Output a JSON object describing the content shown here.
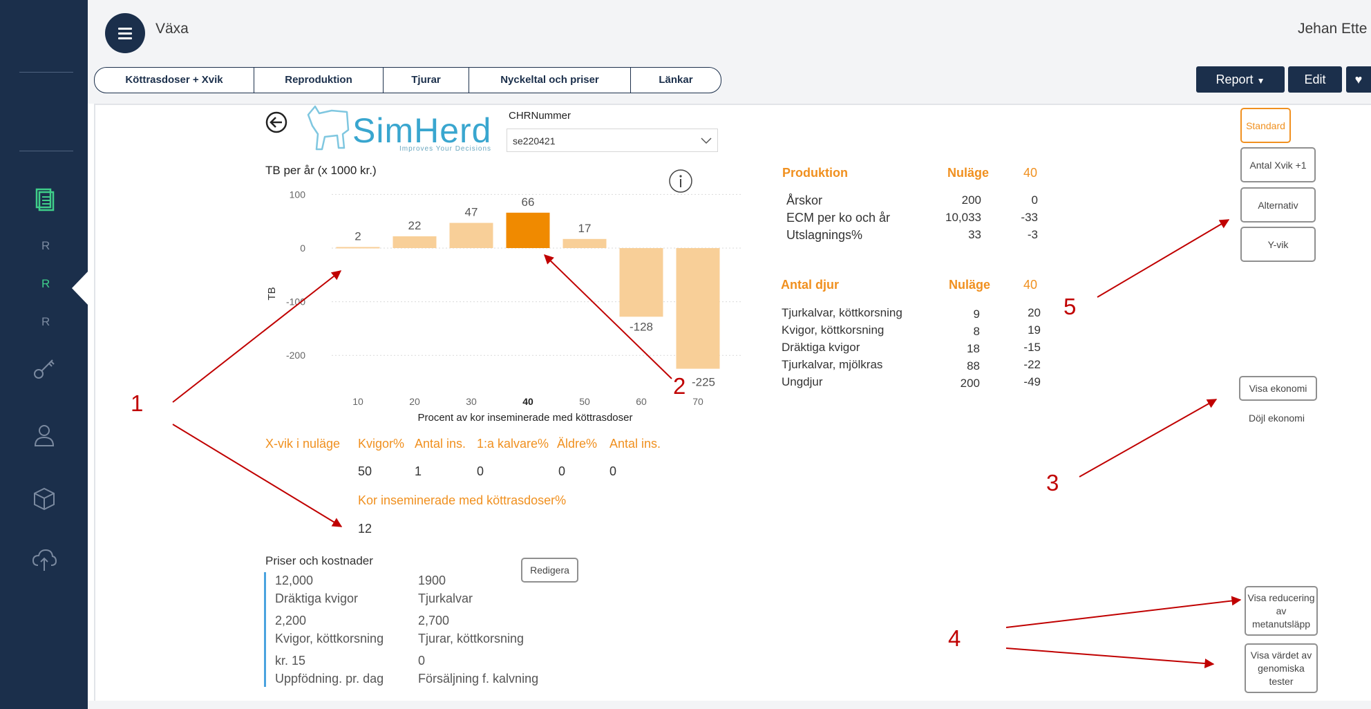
{
  "app": {
    "title": "Växa",
    "user": "Jehan Ette"
  },
  "sidebar": {
    "items": [
      {
        "label": "R",
        "active": false
      },
      {
        "label": "R",
        "active": true
      },
      {
        "label": "R",
        "active": false
      }
    ],
    "icons": [
      "report-icon",
      "key-icon",
      "user-icon",
      "cube-icon",
      "cloud-upload-icon"
    ]
  },
  "tabs": [
    "Köttrasdoser + Xvik",
    "Reproduktion",
    "Tjurar",
    "Nyckeltal och priser",
    "Länkar"
  ],
  "toolbar": {
    "report_label": "Report",
    "edit_label": "Edit",
    "favorite_icon": "heart-icon"
  },
  "header": {
    "logo_text": "SimHerd",
    "logo_tagline": "Improves Your Decisions",
    "chr_label": "CHRNummer",
    "chr_value": "se220421"
  },
  "chart_data": {
    "type": "bar",
    "title": "TB per år (x 1000 kr.)",
    "xlabel": "Procent av kor inseminerade med köttrasdoser",
    "ylabel": "TB",
    "categories": [
      "10",
      "20",
      "30",
      "40",
      "50",
      "60",
      "70"
    ],
    "values": [
      2,
      22,
      47,
      66,
      17,
      -128,
      -225
    ],
    "value_labels": [
      "2",
      "22",
      "47",
      "66",
      "17",
      "-128",
      "-225"
    ],
    "highlight_category": "40",
    "ylim": [
      -240,
      105
    ],
    "yticks": [
      100,
      0,
      -100,
      -200
    ],
    "ytick_labels": [
      "100",
      "0",
      "-100",
      "-200"
    ],
    "grid": true,
    "colors": {
      "bar": "#f8cf98",
      "highlight": "#f08a00"
    }
  },
  "xvik": {
    "label": "X-vik i nuläge",
    "headers": [
      "Kvigor%",
      "Antal ins.",
      "1:a kalvare%",
      "Äldre%",
      "Antal ins."
    ],
    "values": [
      "50",
      "1",
      "0",
      "0",
      "0"
    ],
    "kor_label": "Kor inseminerade med köttrasdoser%",
    "kor_value": "12"
  },
  "prices": {
    "title": "Priser och kostnader",
    "edit_label": "Redigera",
    "items": [
      {
        "value": "12,000",
        "label": "Dräktiga kvigor"
      },
      {
        "value": "1900",
        "label": "Tjurkalvar"
      },
      {
        "value": "2,200",
        "label": "Kvigor, köttkorsning"
      },
      {
        "value": "2,700",
        "label": "Tjurar, köttkorsning"
      },
      {
        "value": "kr. 15",
        "label": "Uppfödning. pr. dag"
      },
      {
        "value": "0",
        "label": "Försäljning f. kalvning"
      }
    ]
  },
  "produktion": {
    "title": "Produktion",
    "col1": "Nuläge",
    "col2": "40",
    "rows": [
      {
        "label": "Årskor",
        "now": "200",
        "diff": "0"
      },
      {
        "label": "ECM per ko och år",
        "now": "10,033",
        "diff": "-33"
      },
      {
        "label": "Utslagnings%",
        "now": "33",
        "diff": "-3"
      }
    ]
  },
  "antal_djur": {
    "title": "Antal djur",
    "col1": "Nuläge",
    "col2": "40",
    "rows": [
      {
        "label": "Tjurkalvar, köttkorsning",
        "now": "9",
        "diff": "20"
      },
      {
        "label": "Kvigor, köttkorsning",
        "now": "8",
        "diff": "19"
      },
      {
        "label": "Dräktiga kvigor",
        "now": "18",
        "diff": "-15"
      },
      {
        "label": "Tjurkalvar, mjölkras",
        "now": "88",
        "diff": "-22"
      },
      {
        "label": "Ungdjur",
        "now": "200",
        "diff": "-49"
      }
    ]
  },
  "scenario_buttons": [
    "Standard",
    "Antal Xvik +1",
    "Alternativ",
    "Y-vik"
  ],
  "economy": {
    "show_label": "Visa ekonomi",
    "hide_label": "Döjl ekonomi"
  },
  "extra_buttons": [
    "Visa reducering av metanutsläpp",
    "Visa värdet av genomiska tester"
  ],
  "annotations": [
    "1",
    "2",
    "3",
    "4",
    "5"
  ],
  "colors": {
    "navy": "#1b2f4b",
    "accent": "#f0901f",
    "annotation": "#c00000",
    "sidebar_active": "#3fcf8a"
  }
}
